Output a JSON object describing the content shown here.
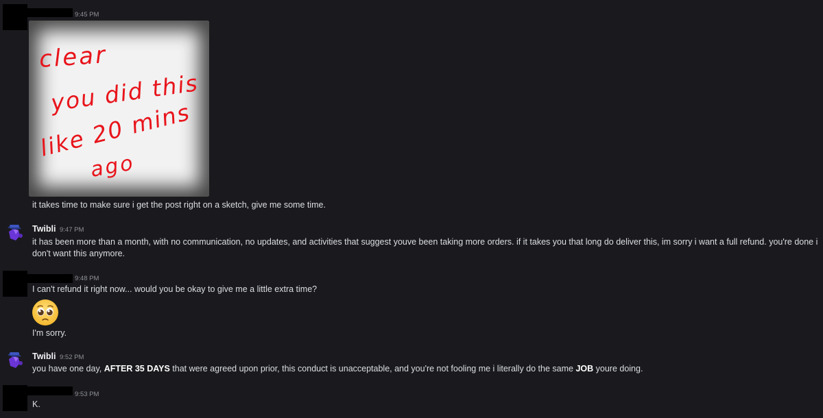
{
  "messages": {
    "m1": {
      "time": "9:45 PM",
      "sketch_text": [
        "clear",
        "you did this",
        "like 20 mins",
        "ago"
      ],
      "text": "it takes time to make sure i get the post right on a sketch, give me some time."
    },
    "m2": {
      "author": "Twibli",
      "time": "9:47 PM",
      "line1": "it has been more than a month, with no communication, no updates, and activities that suggest youve been taking more orders. if it takes you that long do deliver this, im sorry i want a full refund. you're done i",
      "line2": "don't want this anymore."
    },
    "m3": {
      "time": "9:48 PM",
      "text": "I can't refund it right now... would you be okay to give me a little extra time?",
      "emoji": "pleading-face",
      "text2": "I'm sorry."
    },
    "m4": {
      "author": "Twibli",
      "time": "9:52 PM",
      "part1": "you have one day, ",
      "bold1": "AFTER 35 DAYS",
      "part2": " that were agreed upon prior, this conduct is unacceptable, and you're not fooling me i literally do the same ",
      "bold2": "JOB",
      "part3": " youre doing."
    },
    "m5": {
      "time": "9:53 PM",
      "text": "K."
    }
  },
  "colors": {
    "background": "#1a1a1e",
    "text": "#dbdee1",
    "timestamp": "#8e9097",
    "sketch_ink": "#e8141b",
    "avatar_accent": "#7b3fe4"
  }
}
